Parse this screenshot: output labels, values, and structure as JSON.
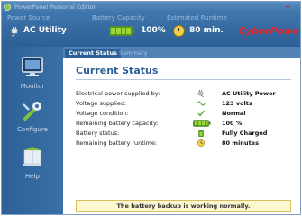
{
  "window": {
    "title": "PowerPanel Personal Edition"
  },
  "header": {
    "power_source": {
      "label": "Power Source",
      "value": "AC Utility",
      "icon": "plug-icon"
    },
    "battery_capacity": {
      "label": "Battery Capacity",
      "value": "100%",
      "level": 1.0,
      "icon": "battery-icon"
    },
    "runtime": {
      "label": "Estimated Runtime",
      "value": "80 min.",
      "icon": "clock-icon"
    },
    "logo": "CyberPower"
  },
  "sidebar": {
    "items": [
      {
        "label": "Monitor",
        "icon": "monitor-icon",
        "active": true
      },
      {
        "label": "Configure",
        "icon": "wrench-icon",
        "active": false
      },
      {
        "label": "Help",
        "icon": "help-icon",
        "active": false
      }
    ]
  },
  "tabs": [
    {
      "label": "Current Status",
      "active": true
    },
    {
      "label": "Summary",
      "active": false
    }
  ],
  "main": {
    "title": "Current Status",
    "rows": [
      {
        "label": "Electrical power supplied by:",
        "icon": "plug-icon",
        "value": "AC Utility Power"
      },
      {
        "label": "Voltage supplied:",
        "icon": "voltage-wave-icon",
        "value": "123 volts"
      },
      {
        "label": "Voltage condition:",
        "icon": "check-icon",
        "value": "Normal"
      },
      {
        "label": "Remaining battery capacity:",
        "icon": "battery-icon",
        "value": "100 %"
      },
      {
        "label": "Battery status:",
        "icon": "battery-small-icon",
        "value": "Fully Charged"
      },
      {
        "label": "Remaining battery runtime:",
        "icon": "clock-icon",
        "value": "80 minutes"
      }
    ],
    "footer": "The battery backup is working normally."
  },
  "colors": {
    "header_bg": "#3f76ab",
    "title_color": "#2c5f95",
    "logo_color": "#e4242a",
    "battery_green": "#9ad63a"
  }
}
